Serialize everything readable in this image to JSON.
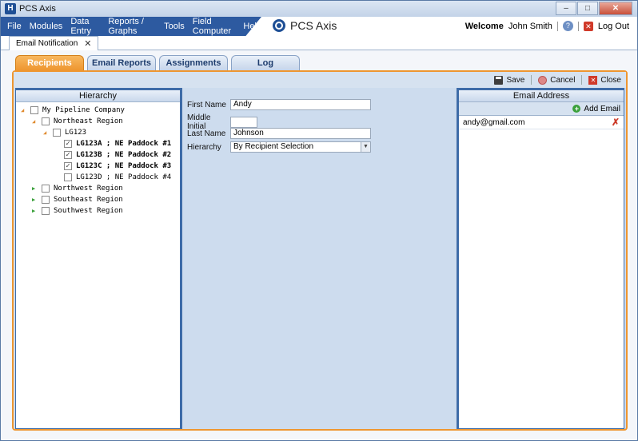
{
  "window": {
    "title": "PCS Axis"
  },
  "menu": [
    "File",
    "Modules",
    "Data Entry",
    "Reports / Graphs",
    "Tools",
    "Field Computer",
    "Help"
  ],
  "brand": "PCS Axis",
  "user": {
    "welcome": "Welcome",
    "name": "John Smith",
    "logout": "Log Out"
  },
  "doc_tab": {
    "label": "Email Notification"
  },
  "tabs": [
    "Recipients",
    "Email Reports",
    "Assignments",
    "Log"
  ],
  "toolbar": {
    "save": "Save",
    "cancel": "Cancel",
    "close": "Close"
  },
  "hierarchy": {
    "header": "Hierarchy",
    "nodes": [
      {
        "label": "My Pipeline Company",
        "checked": false,
        "bold": false
      },
      {
        "label": "Northeast Region",
        "checked": false,
        "bold": false
      },
      {
        "label": "LG123",
        "checked": false,
        "bold": false
      },
      {
        "label": "LG123A ; NE Paddock #1",
        "checked": true,
        "bold": true
      },
      {
        "label": "LG123B ; NE Paddock #2",
        "checked": true,
        "bold": true
      },
      {
        "label": "LG123C ; NE Paddock #3",
        "checked": true,
        "bold": true
      },
      {
        "label": "LG123D ; NE Paddock #4",
        "checked": false,
        "bold": false
      },
      {
        "label": "Northwest Region",
        "checked": false,
        "bold": false
      },
      {
        "label": "Southeast Region",
        "checked": false,
        "bold": false
      },
      {
        "label": "Southwest Region",
        "checked": false,
        "bold": false
      }
    ]
  },
  "form": {
    "first_name_label": "First Name",
    "first_name": "Andy",
    "middle_initial_label": "Middle Initial",
    "middle_initial": "",
    "last_name_label": "Last Name",
    "last_name": "Johnson",
    "hierarchy_label": "Hierarchy",
    "hierarchy_value": "By Recipient Selection"
  },
  "email": {
    "header": "Email Address",
    "add_label": "Add Email",
    "addresses": [
      "andy@gmail.com"
    ]
  }
}
